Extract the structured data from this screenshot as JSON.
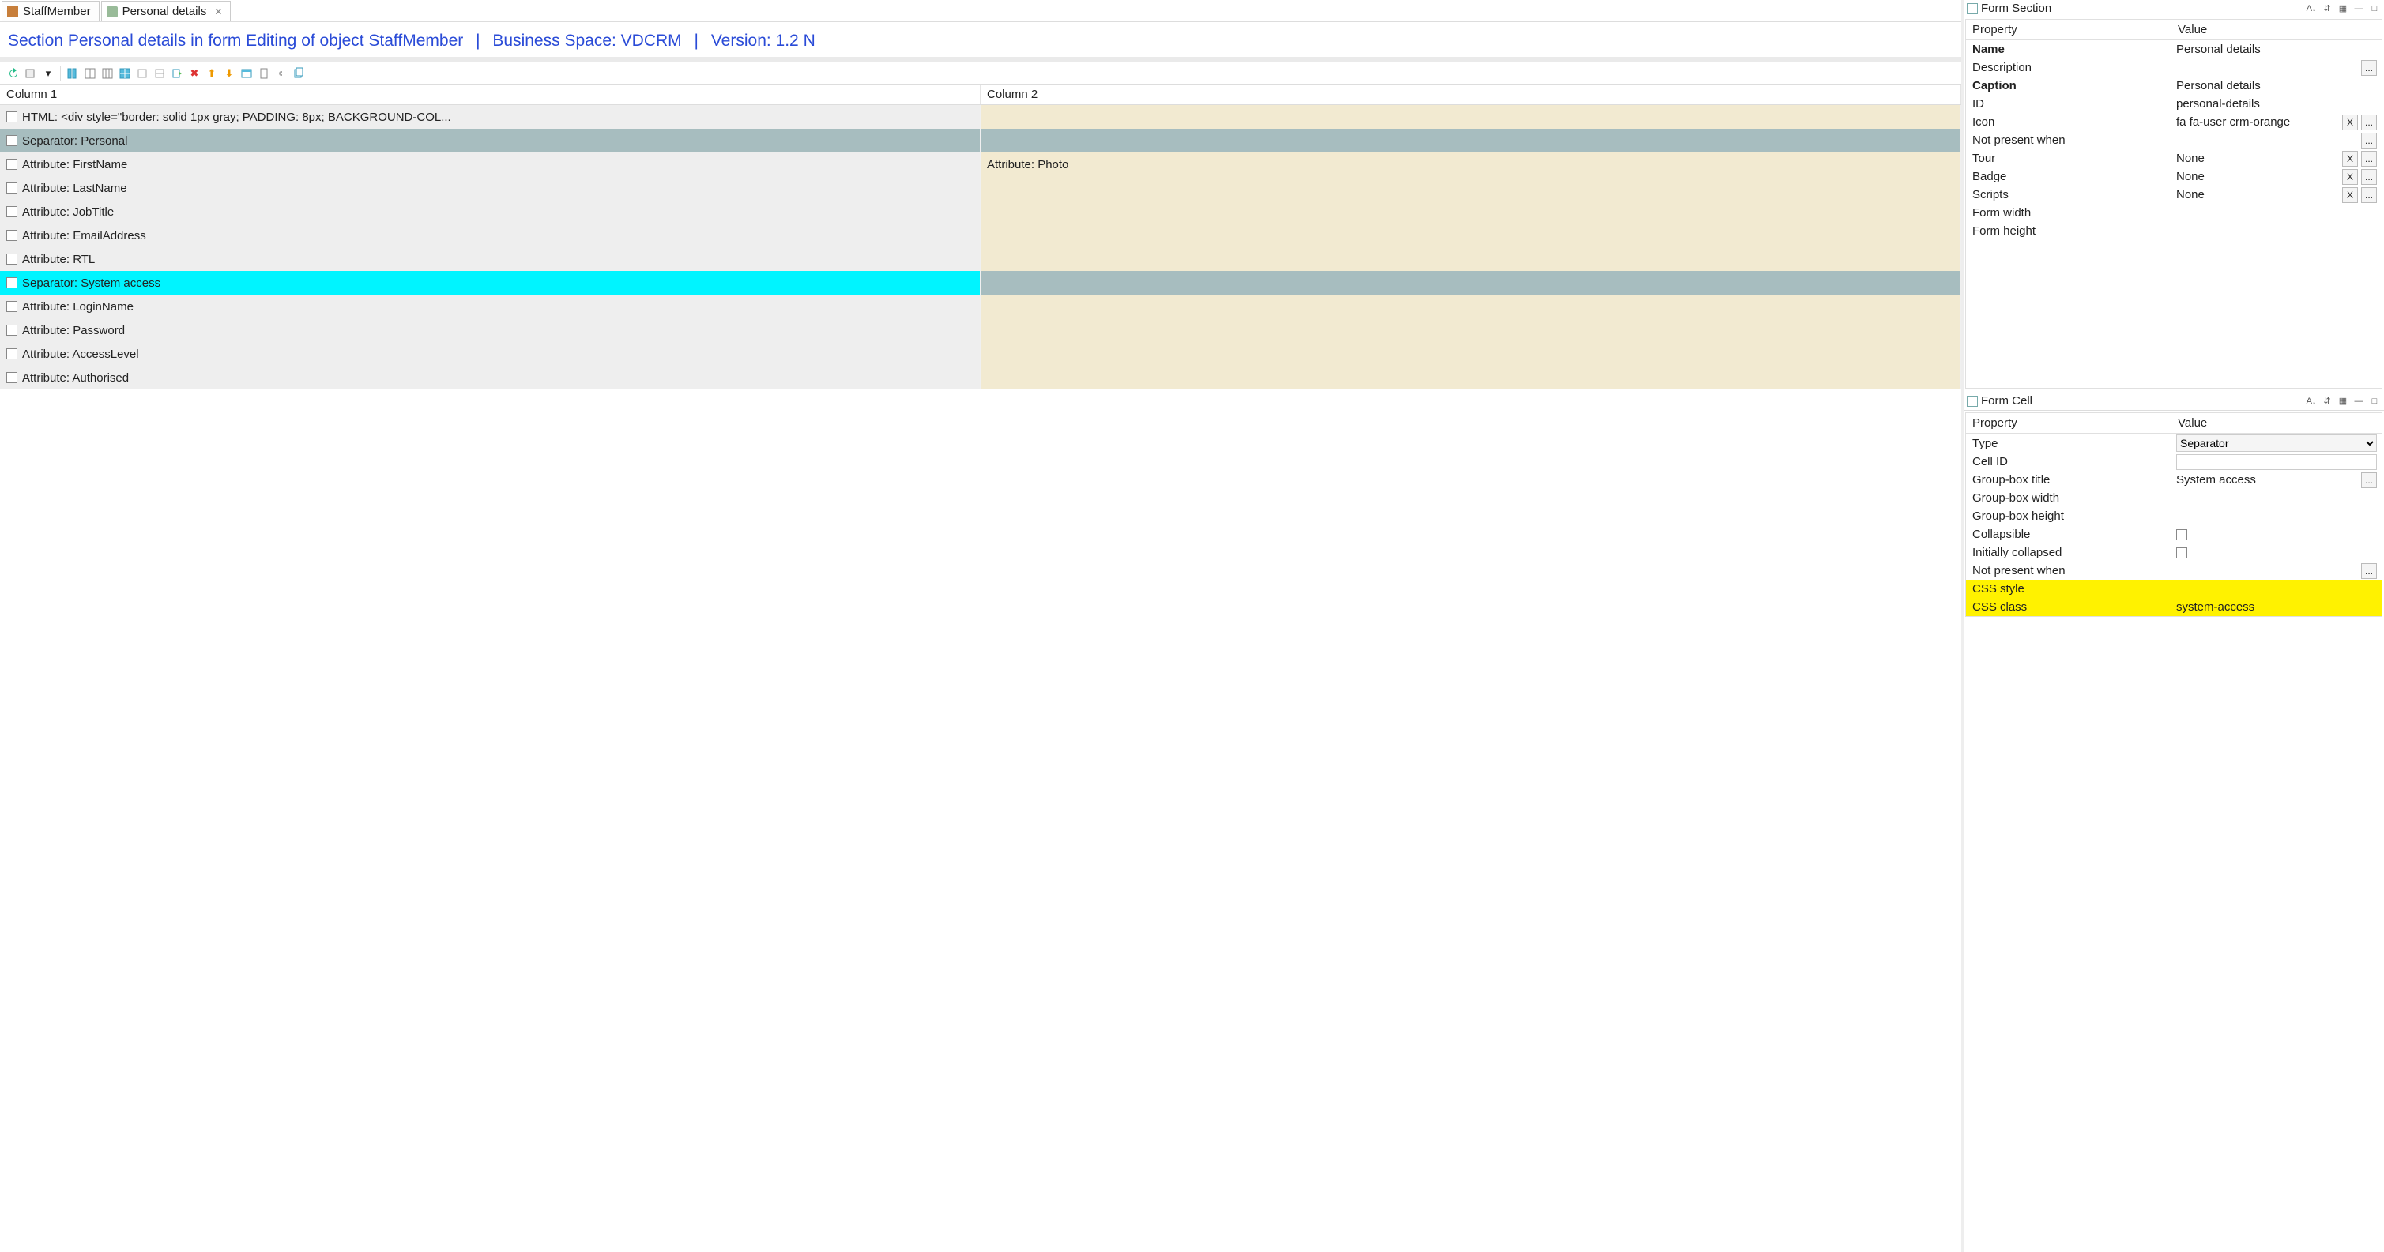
{
  "tabs": [
    {
      "label": "StaffMember",
      "icon": "grid-icon",
      "active": false
    },
    {
      "label": "Personal details",
      "icon": "form-icon",
      "active": true
    }
  ],
  "breadcrumb": {
    "section": "Section Personal details in form Editing of object StaffMember",
    "space": "Business Space: VDCRM",
    "version": "Version: 1.2 N"
  },
  "gridHeaders": {
    "col1": "Column 1",
    "col2": "Column 2"
  },
  "rows": [
    {
      "c1": "HTML: <div style=\"border: solid 1px gray;  PADDING: 8px; BACKGROUND-COL...",
      "c2": "",
      "sep": false,
      "sel": false
    },
    {
      "c1": "Separator: Personal",
      "c2": "",
      "sep": true,
      "sel": false
    },
    {
      "c1": "Attribute: FirstName",
      "c2": "Attribute: Photo",
      "sep": false,
      "sel": false
    },
    {
      "c1": "Attribute: LastName",
      "c2": "",
      "sep": false,
      "sel": false
    },
    {
      "c1": "Attribute: JobTitle",
      "c2": "",
      "sep": false,
      "sel": false
    },
    {
      "c1": "Attribute: EmailAddress",
      "c2": "",
      "sep": false,
      "sel": false
    },
    {
      "c1": "Attribute: RTL",
      "c2": "",
      "sep": false,
      "sel": false
    },
    {
      "c1": "Separator: System access",
      "c2": "",
      "sep": true,
      "sel": true
    },
    {
      "c1": "Attribute: LoginName",
      "c2": "",
      "sep": false,
      "sel": false
    },
    {
      "c1": "Attribute: Password",
      "c2": "",
      "sep": false,
      "sel": false
    },
    {
      "c1": "Attribute: AccessLevel",
      "c2": "",
      "sep": false,
      "sel": false
    },
    {
      "c1": "Attribute: Authorised",
      "c2": "",
      "sep": false,
      "sel": false
    }
  ],
  "formSection": {
    "title": "Form Section",
    "headers": {
      "prop": "Property",
      "val": "Value"
    },
    "rows": [
      {
        "k": "Name",
        "v": "Personal details",
        "bold": true
      },
      {
        "k": "Description",
        "v": "",
        "dots": true
      },
      {
        "k": "Caption",
        "v": "Personal details",
        "bold": true
      },
      {
        "k": "ID",
        "v": "personal-details"
      },
      {
        "k": "Icon",
        "v": "fa fa-user crm-orange",
        "x": true,
        "dots": true
      },
      {
        "k": "Not present when",
        "v": "",
        "dots": true
      },
      {
        "k": "Tour",
        "v": "None",
        "x": true,
        "dots": true
      },
      {
        "k": "Badge",
        "v": "None",
        "x": true,
        "dots": true
      },
      {
        "k": "Scripts",
        "v": "None",
        "x": true,
        "dots": true
      },
      {
        "k": "Form width",
        "v": ""
      },
      {
        "k": "Form height",
        "v": ""
      }
    ]
  },
  "formCell": {
    "title": "Form Cell",
    "headers": {
      "prop": "Property",
      "val": "Value"
    },
    "rows": [
      {
        "k": "Type",
        "v": "Separator",
        "select": true
      },
      {
        "k": "Cell ID",
        "v": "",
        "input": true
      },
      {
        "k": "Group-box title",
        "v": "System access",
        "dots": true
      },
      {
        "k": "Group-box width",
        "v": ""
      },
      {
        "k": "Group-box height",
        "v": ""
      },
      {
        "k": "Collapsible",
        "v": "",
        "check": true
      },
      {
        "k": "Initially collapsed",
        "v": "",
        "check": true
      },
      {
        "k": "Not present when",
        "v": "",
        "dots": true
      },
      {
        "k": "CSS style",
        "v": "",
        "hl": true
      },
      {
        "k": "CSS class",
        "v": "system-access",
        "hl": true
      }
    ]
  }
}
